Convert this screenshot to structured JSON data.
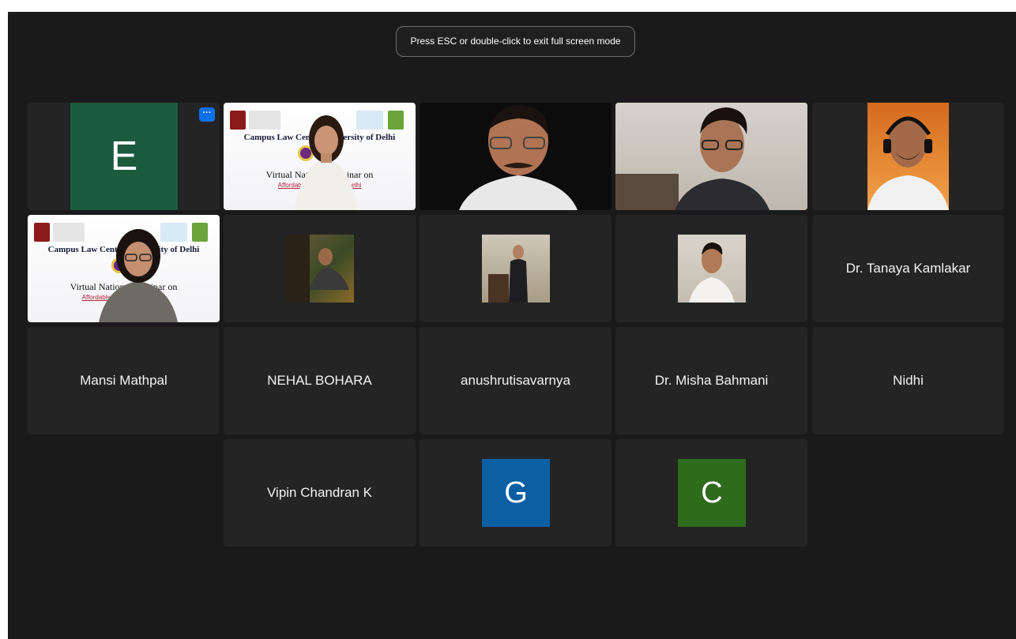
{
  "banner": {
    "text": "Press ESC or double-click to exit full screen mode"
  },
  "tiles": [
    {
      "kind": "avatar",
      "letter": "E",
      "color": "#1c5a3e"
    },
    {
      "kind": "video-slide",
      "slide_title": "Campus Law Centre, University of Delhi",
      "slide_sub": "Virtual National Webinar on",
      "slide_sub2": "Affordable Shelters ... in Delhi"
    },
    {
      "kind": "video"
    },
    {
      "kind": "video",
      "speaking": true
    },
    {
      "kind": "video"
    },
    {
      "kind": "video-slide",
      "slide_title": "Campus Law Centre, University of Delhi",
      "slide_sub": "Virtual National Webinar on",
      "slide_sub2": "Affordable Shelters ... in Delhi"
    },
    {
      "kind": "photo"
    },
    {
      "kind": "photo"
    },
    {
      "kind": "photo"
    },
    {
      "kind": "name",
      "name": "Dr. Tanaya Kamlakar"
    },
    {
      "kind": "name",
      "name": "Mansi Mathpal"
    },
    {
      "kind": "name",
      "name": "NEHAL BOHARA"
    },
    {
      "kind": "name",
      "name": "anushrutisavarnya"
    },
    {
      "kind": "name",
      "name": "Dr. Misha Bahmani"
    },
    {
      "kind": "name",
      "name": "Nidhi"
    },
    {
      "kind": "name",
      "name": "Vipin Chandran K"
    },
    {
      "kind": "avatar",
      "letter": "G",
      "color": "#0a5fa3"
    },
    {
      "kind": "avatar",
      "letter": "C",
      "color": "#2f6b1c"
    }
  ],
  "colors": {
    "screen_bg": "#1a1a1a",
    "tile_bg": "#242424",
    "speaker_outline": "#2ecc40",
    "more_button": "#0e71eb"
  }
}
